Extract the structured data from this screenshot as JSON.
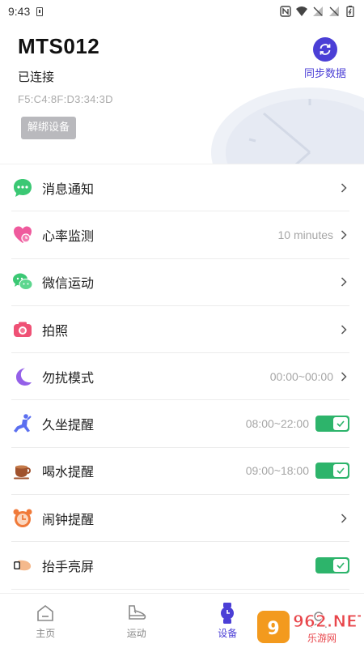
{
  "status_bar": {
    "time": "9:43",
    "icons": [
      "sim-icon",
      "nfc-icon",
      "wifi-icon",
      "no-signal-icon",
      "no-signal-icon",
      "battery-icon"
    ]
  },
  "device": {
    "name": "MTS012",
    "status": "已连接",
    "mac": "F5:C4:8F:D3:34:3D",
    "unbind_label": "解绑设备",
    "sync_label": "同步数据"
  },
  "settings": [
    {
      "label": "消息通知",
      "value": "",
      "control": "chevron",
      "icon": "message-icon"
    },
    {
      "label": "心率监测",
      "value": "10 minutes",
      "control": "chevron",
      "icon": "heart-icon"
    },
    {
      "label": "微信运动",
      "value": "",
      "control": "chevron",
      "icon": "wechat-icon"
    },
    {
      "label": "拍照",
      "value": "",
      "control": "chevron",
      "icon": "camera-icon"
    },
    {
      "label": "勿扰模式",
      "value": "00:00~00:00",
      "control": "chevron",
      "icon": "moon-icon"
    },
    {
      "label": "久坐提醒",
      "value": "08:00~22:00",
      "control": "toggle",
      "on": true,
      "icon": "sedentary-icon"
    },
    {
      "label": "喝水提醒",
      "value": "09:00~18:00",
      "control": "toggle",
      "on": true,
      "icon": "cup-icon"
    },
    {
      "label": "闹钟提醒",
      "value": "",
      "control": "chevron",
      "icon": "alarm-clock-icon"
    },
    {
      "label": "抬手亮屏",
      "value": "",
      "control": "toggle",
      "on": true,
      "icon": "raise-wrist-icon"
    }
  ],
  "nav": {
    "tabs": [
      {
        "label": "主页",
        "icon": "home-icon",
        "active": false
      },
      {
        "label": "运动",
        "icon": "shoe-icon",
        "active": false
      },
      {
        "label": "设备",
        "icon": "watch-icon",
        "active": true
      },
      {
        "label": "",
        "icon": "profile-icon",
        "active": false
      }
    ]
  },
  "watermark": {
    "text": "962.NET",
    "subtext": "乐游网"
  },
  "colors": {
    "accent": "#4b3fd6",
    "toggle_on": "#2db46b",
    "button_gray": "#b9b9bd"
  }
}
